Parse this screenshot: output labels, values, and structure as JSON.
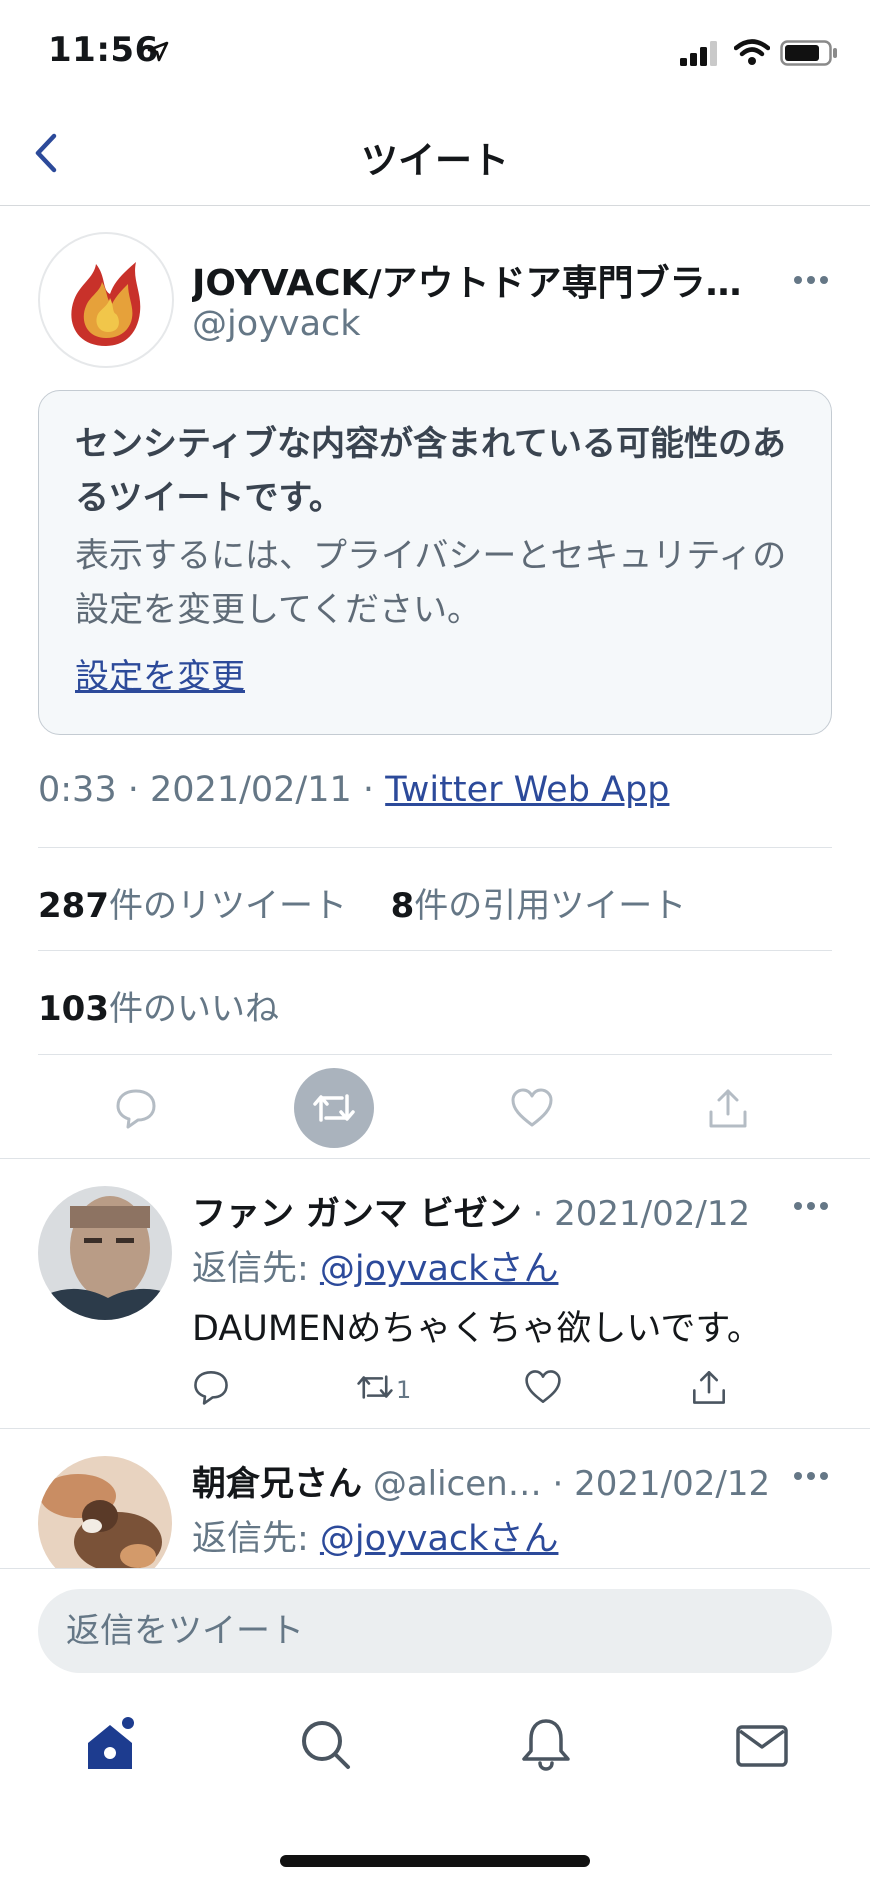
{
  "status_bar": {
    "time": "11:56"
  },
  "nav": {
    "title": "ツイート"
  },
  "tweet": {
    "author_name": "JOYVACK/アウトドア専門ブラ…",
    "author_handle": "@joyvack",
    "sensitive": {
      "title": "センシティブな内容が含まれている可能性のあるツイートです。",
      "body": "表示するには、プライバシーとセキュリティの設定を変更してください。",
      "link": "設定を変更"
    },
    "time": "0:33",
    "sep": "·",
    "date": "2021/02/11",
    "source": "Twitter Web App",
    "retweet_count": "287",
    "retweet_label": "件のリツイート",
    "quote_count": "8",
    "quote_label": "件の引用ツイート",
    "like_count": "103",
    "like_label": "件のいいね"
  },
  "replies": [
    {
      "name": "ファン ガンマ ビゼン",
      "handle": "",
      "date": "· 2021/02/12",
      "reply_to_label": "返信先: ",
      "reply_to_mention": "@joyvackさん",
      "text": "DAUMENめちゃくちゃ欲しいです。",
      "retweet_count": "1"
    },
    {
      "name": "朝倉兄さん",
      "handle": "@alicen…",
      "date": "· 2021/02/12",
      "reply_to_label": "返信先: ",
      "reply_to_mention": "@joyvackさん"
    }
  ],
  "compose": {
    "placeholder": "返信をツイート"
  },
  "tabs": {
    "items": [
      "home-icon",
      "search-icon",
      "bell-icon",
      "mail-icon"
    ]
  },
  "colors": {
    "link": "#2c4a9a",
    "dim": "#657786",
    "active_tab": "#1d3c8f"
  }
}
